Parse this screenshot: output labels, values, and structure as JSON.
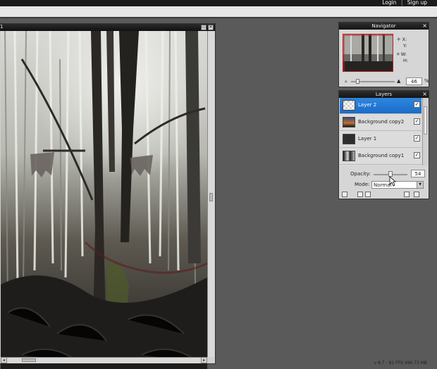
{
  "auth": {
    "login": "Login",
    "separator": "|",
    "signup": "Sign up"
  },
  "document": {
    "title": "1"
  },
  "navigator": {
    "title": "Navigator",
    "x_label": "X:",
    "y_label": "Y:",
    "w_label": "W:",
    "h_label": "H:",
    "zoom_value": "46",
    "zoom_unit": "%"
  },
  "layers": {
    "title": "Layers",
    "items": [
      {
        "name": "Layer 2",
        "selected": true,
        "visible": true,
        "thumb": "transparent"
      },
      {
        "name": "Background copy2",
        "selected": false,
        "visible": true,
        "thumb": "sunset"
      },
      {
        "name": "Layer 1",
        "selected": false,
        "visible": true,
        "thumb": "dark"
      },
      {
        "name": "Background copy1",
        "selected": false,
        "visible": true,
        "thumb": "forest"
      }
    ],
    "opacity_label": "Opacity:",
    "opacity_value": "54",
    "mode_label": "Mode:",
    "mode_value": "Normal"
  },
  "status": "v 8.7 - 81 FPS 496.73 MB",
  "colors": {
    "accent": "#1a6cc8",
    "workspace": "#5a5a5a"
  }
}
